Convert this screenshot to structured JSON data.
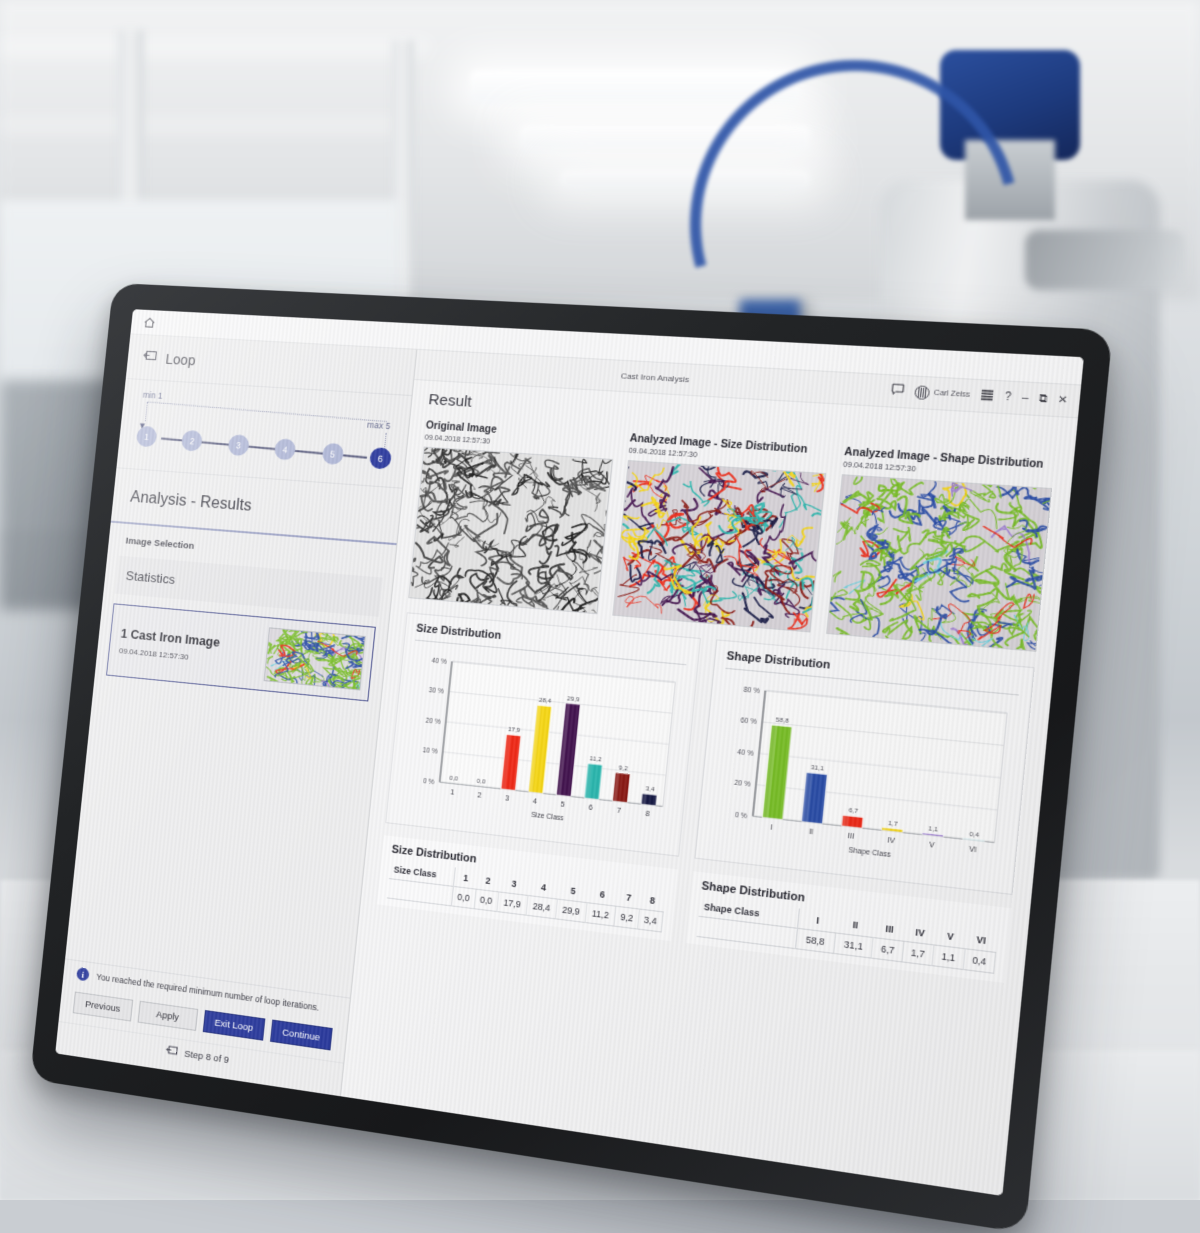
{
  "background": {
    "scene": "laboratory with microscope and blue cable"
  },
  "home_bar": {
    "home_icon": "home-icon"
  },
  "sidebar": {
    "header": {
      "icon": "loop-icon",
      "title": "Loop"
    },
    "loop_steps": {
      "min_label": "min 1",
      "max_label": "max 5",
      "steps": [
        "1",
        "2",
        "3",
        "4",
        "5",
        "6"
      ],
      "active_step": "6"
    },
    "section_title": "Analysis - Results",
    "image_selection_label": "Image Selection",
    "statistics_label": "Statistics",
    "image_card": {
      "title": "1 Cast Iron Image",
      "date": "09.04.2018 12:57:30",
      "thumbnail": "cast-iron-analyzed-thumbnail"
    },
    "info": {
      "icon": "info-icon",
      "message": "You reached the required minimum number of loop iterations."
    },
    "buttons": [
      {
        "label": "Previous",
        "primary": false
      },
      {
        "label": "Apply",
        "primary": false
      },
      {
        "label": "Exit Loop",
        "primary": true
      },
      {
        "label": "Continue",
        "primary": true
      }
    ],
    "step_counter": {
      "icon": "loop-icon",
      "text": "Step 8 of 9"
    }
  },
  "window": {
    "title": "Cast Iron Analysis",
    "tools": {
      "chat_icon": "chat-icon",
      "brand": "Carl Zeiss",
      "menu_icon": "menu-icon",
      "help": "?",
      "minimize": "–",
      "restore": "⧉",
      "close": "✕"
    }
  },
  "main": {
    "result_title": "Result",
    "images": [
      {
        "title": "Original Image",
        "date": "09.04.2018 12:57:30",
        "kind": "grayscale"
      },
      {
        "title": "Analyzed Image - Size Distribution",
        "date": "09.04.2018 12:57:30",
        "kind": "size"
      },
      {
        "title": "Analyzed Image - Shape Distribution",
        "date": "09.04.2018 12:57:30",
        "kind": "shape"
      }
    ],
    "size_table": {
      "title": "Size Distribution",
      "row_header": "Size Class",
      "columns": [
        "1",
        "2",
        "3",
        "4",
        "5",
        "6",
        "7",
        "8"
      ],
      "values": [
        "0,0",
        "0,0",
        "17,9",
        "28,4",
        "29,9",
        "11,2",
        "9,2",
        "3,4"
      ]
    },
    "shape_table": {
      "title": "Shape Distribution",
      "row_header": "Shape Class",
      "columns": [
        "I",
        "II",
        "III",
        "IV",
        "V",
        "VI"
      ],
      "values": [
        "58,8",
        "31,1",
        "6,7",
        "1,7",
        "1,1",
        "0,4"
      ]
    }
  },
  "chart_data": [
    {
      "type": "bar",
      "title": "Size Distribution",
      "xlabel": "Size Class",
      "ylabel": "",
      "categories": [
        "1",
        "2",
        "3",
        "4",
        "5",
        "6",
        "7",
        "8"
      ],
      "values": [
        0.0,
        0.0,
        17.9,
        28.4,
        29.9,
        11.2,
        9.2,
        3.4
      ],
      "data_labels": [
        "0,0",
        "0,0",
        "17,9",
        "28,4",
        "29,9",
        "11,2",
        "9,2",
        "3,4"
      ],
      "colors": [
        "#b7b7bb",
        "#b7b7bb",
        "#ee2a18",
        "#f5d617",
        "#43144f",
        "#2bb6ae",
        "#8a1a15",
        "#171a45"
      ],
      "ylim": [
        0,
        40
      ],
      "yticks": [
        "0 %",
        "10 %",
        "20 %",
        "30 %",
        "40 %"
      ],
      "grid": true,
      "legend": "none"
    },
    {
      "type": "bar",
      "title": "Shape Distribution",
      "xlabel": "Shape Class",
      "ylabel": "",
      "categories": [
        "I",
        "II",
        "III",
        "IV",
        "V",
        "VI"
      ],
      "values": [
        58.8,
        31.1,
        6.7,
        1.7,
        1.1,
        0.4
      ],
      "data_labels": [
        "58,8",
        "31,1",
        "6,7",
        "1,7",
        "1,1",
        "0,4"
      ],
      "colors": [
        "#79bf28",
        "#2b4ea8",
        "#ee2a18",
        "#f5d617",
        "#9f7fd4",
        "#6fd3e0"
      ],
      "ylim": [
        0,
        80
      ],
      "yticks": [
        "0 %",
        "20 %",
        "40 %",
        "60 %",
        "80 %"
      ],
      "grid": true,
      "legend": "none"
    }
  ]
}
